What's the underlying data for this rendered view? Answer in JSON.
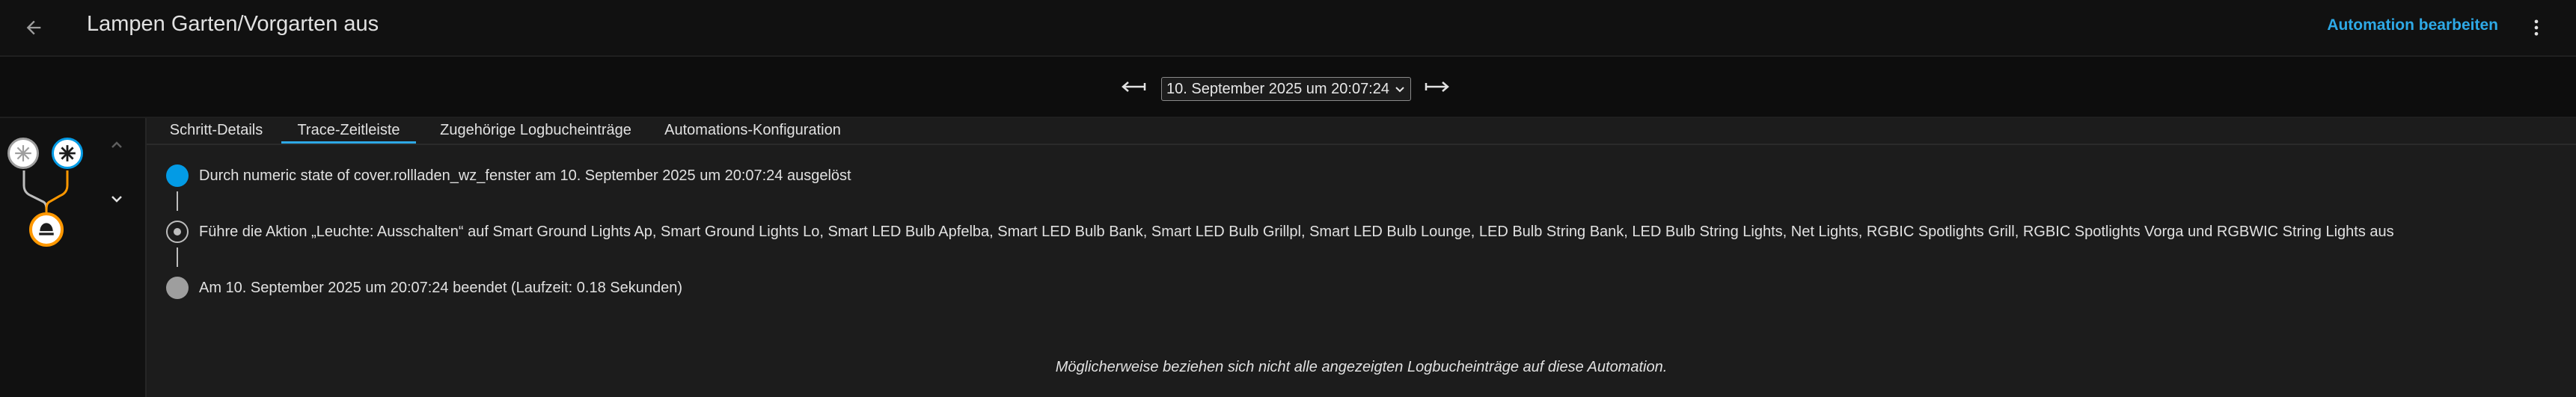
{
  "header": {
    "title": "Lampen Garten/Vorgarten aus",
    "edit_label": "Automation bearbeiten"
  },
  "trace_selector": {
    "selected": "10. September 2025 um 20:07:24"
  },
  "tabs": [
    {
      "label": "Schritt-Details",
      "active": false
    },
    {
      "label": "Trace-Zeitleiste",
      "active": true
    },
    {
      "label": "Zugehörige Logbucheinträge",
      "active": false
    },
    {
      "label": "Automations-Konfiguration",
      "active": false
    }
  ],
  "timeline": [
    {
      "text": "Durch numeric state of cover.rollladen_wz_fenster am 10. September 2025 um 20:07:24 ausgelöst",
      "icon": "trigger-icon"
    },
    {
      "text": "Führe die Aktion „Leuchte: Ausschalten“ auf Smart Ground Lights Ap, Smart Ground Lights Lo, Smart LED Bulb Apfelba, Smart LED Bulb Bank, Smart LED Bulb Grillpl, Smart LED Bulb Lounge, LED Bulb String Bank, LED Bulb String Lights, Net Lights, RGBIC Spotlights Grill, RGBIC Spotlights Vorga und RGBWIC String Lights aus",
      "icon": "action-icon"
    },
    {
      "text": "Am 10. September 2025 um 20:07:24 beendet (Laufzeit: 0.18 Sekunden)",
      "icon": "finished-icon"
    }
  ],
  "footnote": "Möglicherweise beziehen sich nicht alle angezeigten Logbucheinträge auf diese Automation.",
  "colors": {
    "accent": "#2ea9e6",
    "trigger": "#039be5",
    "action_path": "#ff9800",
    "finished": "#9e9e9e"
  }
}
